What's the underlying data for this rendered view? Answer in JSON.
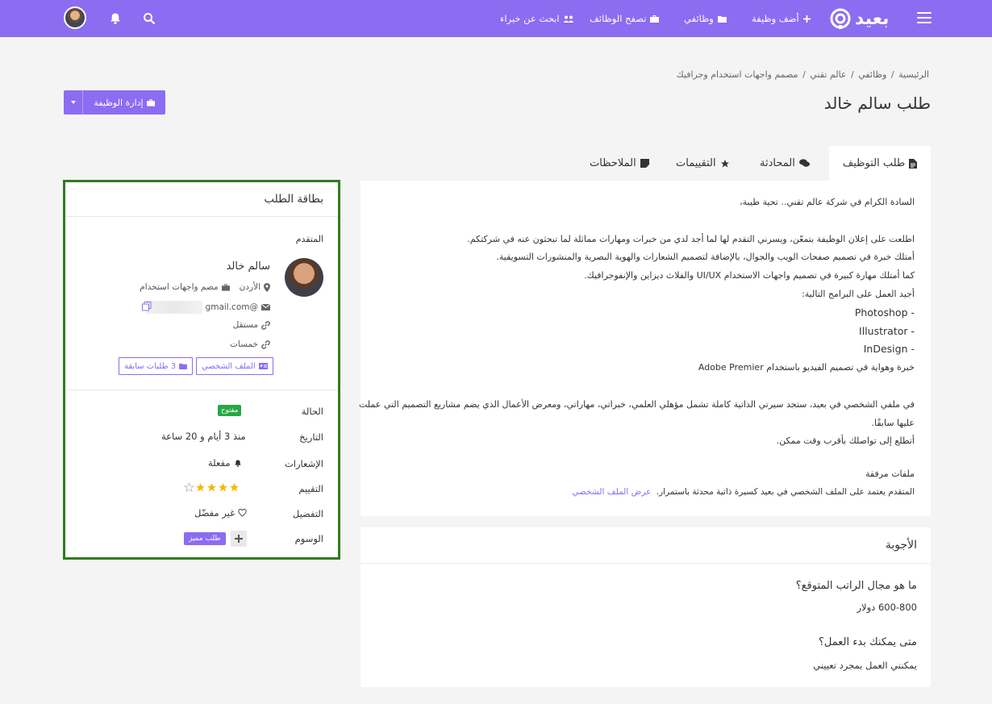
{
  "nav": {
    "logo_text": "بعيد",
    "items": [
      {
        "label": "أضف وظيفة",
        "icon": "plus-icon"
      },
      {
        "label": "وظائفي",
        "icon": "folder-icon"
      },
      {
        "label": "تصفح الوظائف",
        "icon": "briefcase-icon"
      },
      {
        "label": "ابحث عن خبراء",
        "icon": "users-icon"
      }
    ],
    "colors": {
      "primary": "#8c6cf1"
    }
  },
  "breadcrumb": [
    "الرئيسية",
    "وظائفي",
    "عالم تقني",
    "مصمم واجهات استخدام وجرافيك"
  ],
  "page_title": "طلب سالم خالد",
  "manage_button": "إدارة الوظيفة",
  "tabs": [
    {
      "label": "طلب التوظيف",
      "icon": "file-icon"
    },
    {
      "label": "المحادثة",
      "icon": "comments-icon"
    },
    {
      "label": "التقييمات",
      "icon": "star-icon"
    },
    {
      "label": "الملاحظات",
      "icon": "sticky-note-icon"
    }
  ],
  "letter": {
    "lines": [
      "السادة الكرام في شركة عالم تقني.. تحية طيبة،",
      "",
      "اطلعت على إعلان الوظيفة بتمعّن، ويسرني التقدم لها لما أجد لدي من خبرات ومهارات مماثلة لما تبحثون عنه في شركتكم.",
      "أمتلك خبرة في تصميم صفحات الويب والجوال، بالإضافة لتصميم الشعارات والهوية البصرية والمنشورات التسويقية.",
      "كما أمتلك مهارة كبيرة في تصميم واجهات الاستخدام UI/UX والفلاث ديزاين والإنفوجرافيك.",
      "أجيد العمل على البرامج التالية:",
      "- Photoshop",
      "- Illustrator",
      "- InDesign",
      "خبرة وهواية في تصميم الفيديو باستخدام Adobe Premier",
      "",
      "في ملفي الشخصي في بعيد، ستجد سيرتي الذاتية كاملة تشمل مؤهلي العلمي، خبراتي، مهاراتي، ومعرض الأعمال الذي يضم مشاريع التصميم التي عملت",
      "عليها سابقًا.",
      "أتطلع إلى تواصلك بأقرب وقت ممكن."
    ]
  },
  "attachments": {
    "title": "ملفات مرفقة",
    "description": "المتقدم يعتمد على الملف الشخصي في بعيد كسيرة ذاتية محدثة باستمرار.",
    "link": "عرض الملف الشخصي"
  },
  "answers": {
    "title": "الأجوبة",
    "items": [
      {
        "q": "ما هو مجال الراتب المتوقع؟",
        "a": "600-800 دولار"
      },
      {
        "q": "متى يمكنك بدء العمل؟",
        "a": "يمكنني العمل بمجرد تعييني"
      }
    ]
  },
  "side_card": {
    "title": "بطاقة الطلب",
    "applicant_label": "المتقدم",
    "name": "سالم خالد",
    "location": "الأردن",
    "job": "مصم واجهات استخدام",
    "email": "@gmail.com",
    "work_type": "مستقل",
    "username": "خمسات",
    "profile_button": "الملف الشخصي",
    "previous_button": "3 طلبات سابقة",
    "rows": {
      "status_label": "الحالة",
      "status_value": "مفتوح",
      "date_label": "التاريخ",
      "date_value": "منذ 3 أيام و 20 ساعة",
      "notifications_label": "الإشعارات",
      "notifications_value": "مفعلة",
      "rating_label": "التقييم",
      "rating": 4,
      "rating_max": 5,
      "favorite_label": "التفضيل",
      "favorite_value": "غير مفضّل",
      "tags_label": "الوسوم",
      "tag": "طلب مميز"
    },
    "colors": {
      "border": "#2e7d1e",
      "status": "#28a745",
      "star": "#f5b800"
    }
  }
}
